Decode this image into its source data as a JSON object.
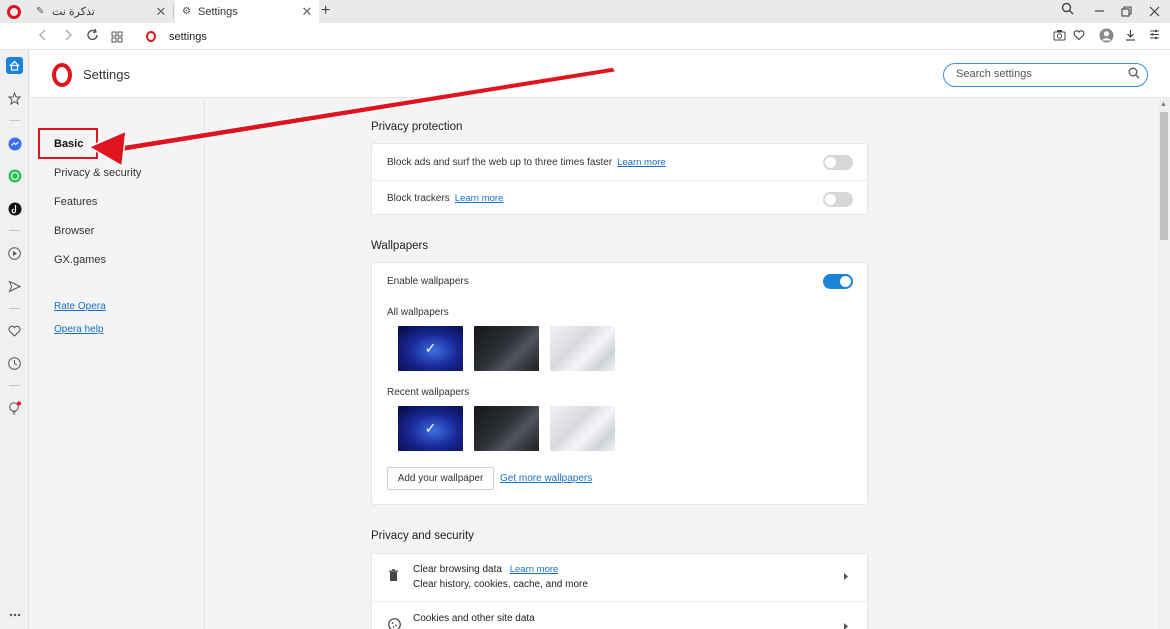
{
  "tabs": [
    {
      "title": "تذكرة نت",
      "icon": "tool-icon"
    },
    {
      "title": "Settings",
      "icon": "gear-icon"
    }
  ],
  "tab_close_glyph": "✕",
  "new_tab_glyph": "+",
  "address": {
    "url": "settings"
  },
  "settings": {
    "title": "Settings",
    "search_placeholder": "Search settings"
  },
  "nav": {
    "items": [
      {
        "label": "Basic",
        "active": true
      },
      {
        "label": "Privacy & security"
      },
      {
        "label": "Features"
      },
      {
        "label": "Browser"
      },
      {
        "label": "GX.games"
      }
    ],
    "links": [
      {
        "label": "Rate Opera"
      },
      {
        "label": "Opera help"
      }
    ]
  },
  "privacy_protection": {
    "title": "Privacy protection",
    "rows": [
      {
        "label": "Block ads and surf the web up to three times faster",
        "link": "Learn more",
        "enabled": false
      },
      {
        "label": "Block trackers",
        "link": "Learn more",
        "enabled": false
      }
    ]
  },
  "wallpapers": {
    "title": "Wallpapers",
    "enable_label": "Enable wallpapers",
    "enabled": true,
    "all_label": "All wallpapers",
    "recent_label": "Recent wallpapers",
    "add_button": "Add your wallpaper",
    "more_link": "Get more wallpapers",
    "selected_mark": "✓"
  },
  "privacy_security": {
    "title": "Privacy and security",
    "rows": [
      {
        "label": "Clear browsing data",
        "link": "Learn more",
        "sub": "Clear history, cookies, cache, and more"
      },
      {
        "label": "Cookies and other site data"
      }
    ]
  },
  "colors": {
    "accent": "#1a84d8",
    "opera_red": "#e0141e",
    "link": "#1a6fc7"
  }
}
